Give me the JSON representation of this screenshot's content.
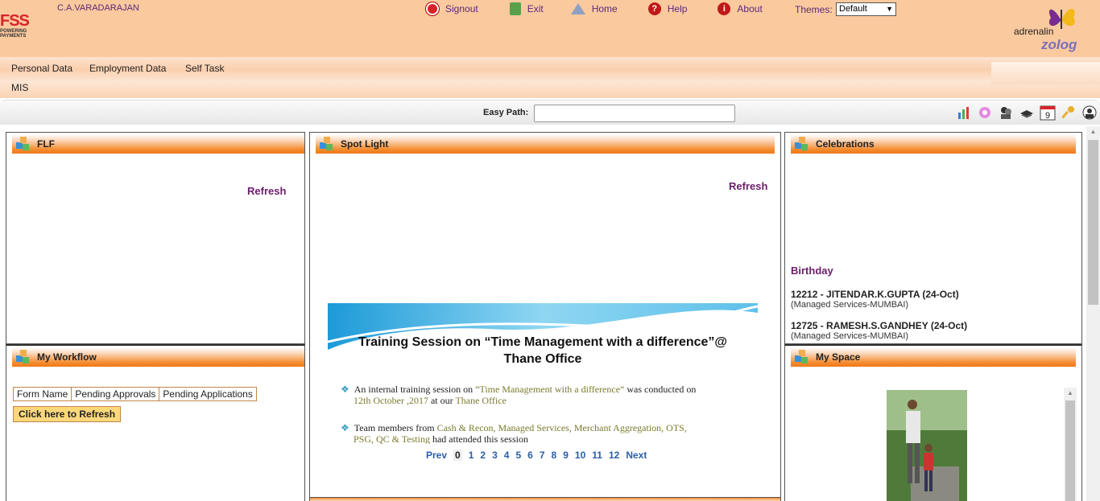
{
  "header": {
    "logo": {
      "brand": "FSS",
      "tagline1": "POWERING",
      "tagline2": "PAYMENTS"
    },
    "username": "C.A.VARADARAJAN",
    "nav": [
      {
        "label": "Signout",
        "icon": "signout-icon",
        "color": "#d8232a"
      },
      {
        "label": "Exit",
        "icon": "exit-icon",
        "color": "#3a8f3a"
      },
      {
        "label": "Home",
        "icon": "home-icon",
        "color": "#6f7fa0"
      },
      {
        "label": "Help",
        "icon": "help-icon",
        "color": "#c01818"
      },
      {
        "label": "About",
        "icon": "about-icon",
        "color": "#c01818"
      }
    ],
    "themes_label": "Themes:",
    "themes_value": "Default",
    "product": {
      "word": "adrenalin",
      "sub": "zolog"
    }
  },
  "menu": {
    "items": [
      "Personal Data",
      "Employment Data",
      "Self Task",
      "MIS"
    ]
  },
  "easy_path": {
    "label": "Easy Path:",
    "value": ""
  },
  "toolbar_icons": [
    "chart-icon",
    "settings-gear-icon",
    "people-icon",
    "book-icon",
    "calendar-icon",
    "key-icon",
    "user-chat-icon"
  ],
  "calendar_day": "9",
  "panels": {
    "flf": {
      "title": "FLF",
      "refresh": "Refresh"
    },
    "spotlight": {
      "title": "Spot Light",
      "refresh": "Refresh",
      "slide": {
        "title_line1": "Training Session on “Time Management with a difference”@",
        "title_line2": "Thane Office",
        "b1_a": "An internal training session on ",
        "b1_hl1": "“Time Management with a difference”",
        "b1_b": " was conducted on",
        "b1_date": "12th October ,2017",
        "b1_c": " at our ",
        "b1_hl2": "Thane Office",
        "b2_a": "Team members from ",
        "b2_hl": "Cash & Recon, Managed Services, Merchant Aggregation, OTS,",
        "b2_hl2": "PSG, QC & Testing",
        "b2_b": " had attended this session"
      },
      "pager": {
        "prev": "Prev",
        "pages": [
          "0",
          "1",
          "2",
          "3",
          "4",
          "5",
          "6",
          "7",
          "8",
          "9",
          "10",
          "11",
          "12"
        ],
        "current": "0",
        "next": "Next"
      }
    },
    "celebrations": {
      "title": "Celebrations",
      "birthday_heading": "Birthday",
      "people": [
        {
          "name": "12212 - JITENDAR.K.GUPTA (24-Oct)",
          "dept": "(Managed Services-MUMBAI)"
        },
        {
          "name": "12725 - RAMESH.S.GANDHEY (24-Oct)",
          "dept": "(Managed Services-MUMBAI)"
        }
      ]
    },
    "workflow": {
      "title": "My Workflow",
      "columns": [
        "Form Name",
        "Pending Approvals",
        "Pending Applications"
      ],
      "refresh_button": "Click here to Refresh"
    },
    "myspace": {
      "title": "My Space"
    }
  }
}
